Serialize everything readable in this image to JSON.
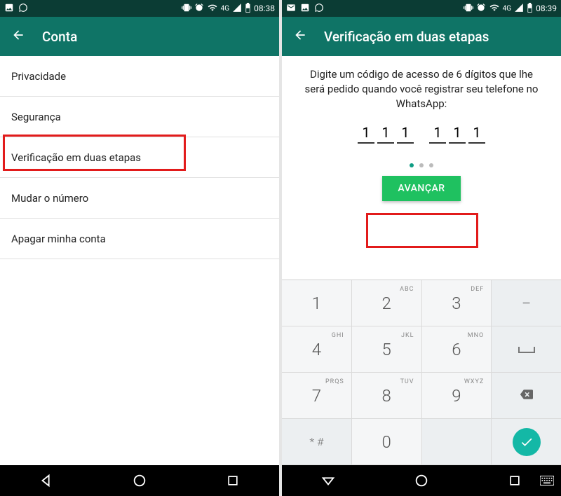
{
  "left": {
    "status_time": "08:38",
    "status_net": "4G",
    "title": "Conta",
    "items": [
      "Privacidade",
      "Segurança",
      "Verificação em duas etapas",
      "Mudar o número",
      "Apagar minha conta"
    ]
  },
  "right": {
    "status_time": "08:39",
    "status_net": "4G",
    "title": "Verificação em duas etapas",
    "instruction": "Digite um código de acesso de 6 dígitos que lhe será pedido quando você registrar seu telefone no WhatsApp:",
    "pin": [
      "1",
      "1",
      "1",
      "1",
      "1",
      "1"
    ],
    "button": "AVANÇAR",
    "keys_letters": {
      "2": "ABC",
      "3": "DEF",
      "4": "GHI",
      "5": "JKL",
      "6": "MNO",
      "7": "PRQS",
      "8": "TUV",
      "9": "WXYZ"
    },
    "key_star": "* #",
    "key_dash": "–"
  }
}
